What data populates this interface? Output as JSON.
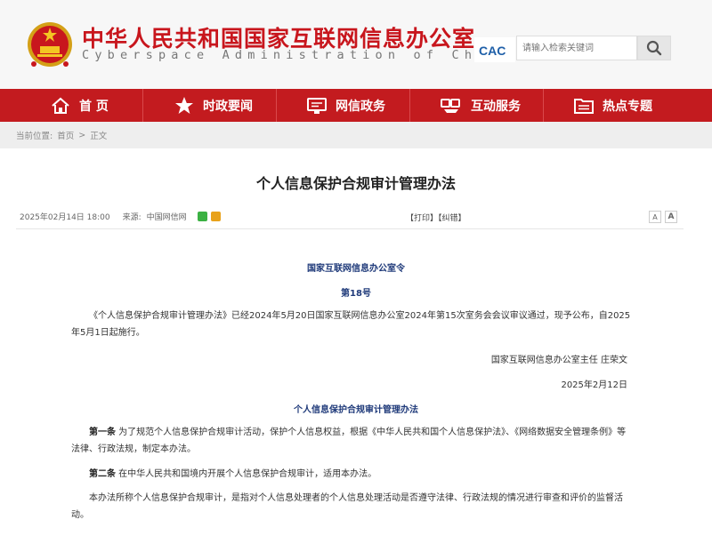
{
  "header": {
    "title": "中华人民共和国国家互联网信息办公室",
    "subtitle": "Cyberspace Administration of China",
    "cac_logo_text": "CAC",
    "search_placeholder": "请输入检索关键词"
  },
  "nav": {
    "items": [
      {
        "label": "首 页",
        "icon": "home-icon"
      },
      {
        "label": "时政要闻",
        "icon": "star-icon"
      },
      {
        "label": "网信政务",
        "icon": "monitor-icon"
      },
      {
        "label": "互动服务",
        "icon": "handshake-icon"
      },
      {
        "label": "热点专题",
        "icon": "folder-icon"
      }
    ]
  },
  "breadcrumb": {
    "prefix": "当前位置:",
    "home": "首页",
    "separator": ">",
    "current": "正文"
  },
  "article": {
    "title": "个人信息保护合规审计管理办法",
    "date": "2025年02月14日 18:00",
    "source_label": "来源:",
    "source": "中国网信网",
    "print": "【打印】",
    "correct": "【纠错】",
    "font_smaller": "A",
    "font_larger": "A",
    "order_issuer": "国家互联网信息办公室令",
    "order_number": "第18号",
    "promulgation": "《个人信息保护合规审计管理办法》已经2024年5月20日国家互联网信息办公室2024年第15次室务会会议审议通过，现予公布，自2025年5月1日起施行。",
    "signature": "国家互联网信息办公室主任 庄荣文",
    "sign_date": "2025年2月12日",
    "doc_title": "个人信息保护合规审计管理办法",
    "art1_label": "第一条",
    "art1_text": " 为了规范个人信息保护合规审计活动，保护个人信息权益，根据《中华人民共和国个人信息保护法》、《网络数据安全管理条例》等法律、行政法规，制定本办法。",
    "art2_label": "第二条",
    "art2_text": " 在中华人民共和国境内开展个人信息保护合规审计，适用本办法。",
    "art2_para2": "本办法所称个人信息保护合规审计，是指对个人信息处理者的个人信息处理活动是否遵守法律、行政法规的情况进行审查和评价的监督活动。"
  },
  "colors": {
    "brand_red": "#c31b1f",
    "title_red": "#c8161d",
    "heading_blue": "#1f3a7a"
  }
}
